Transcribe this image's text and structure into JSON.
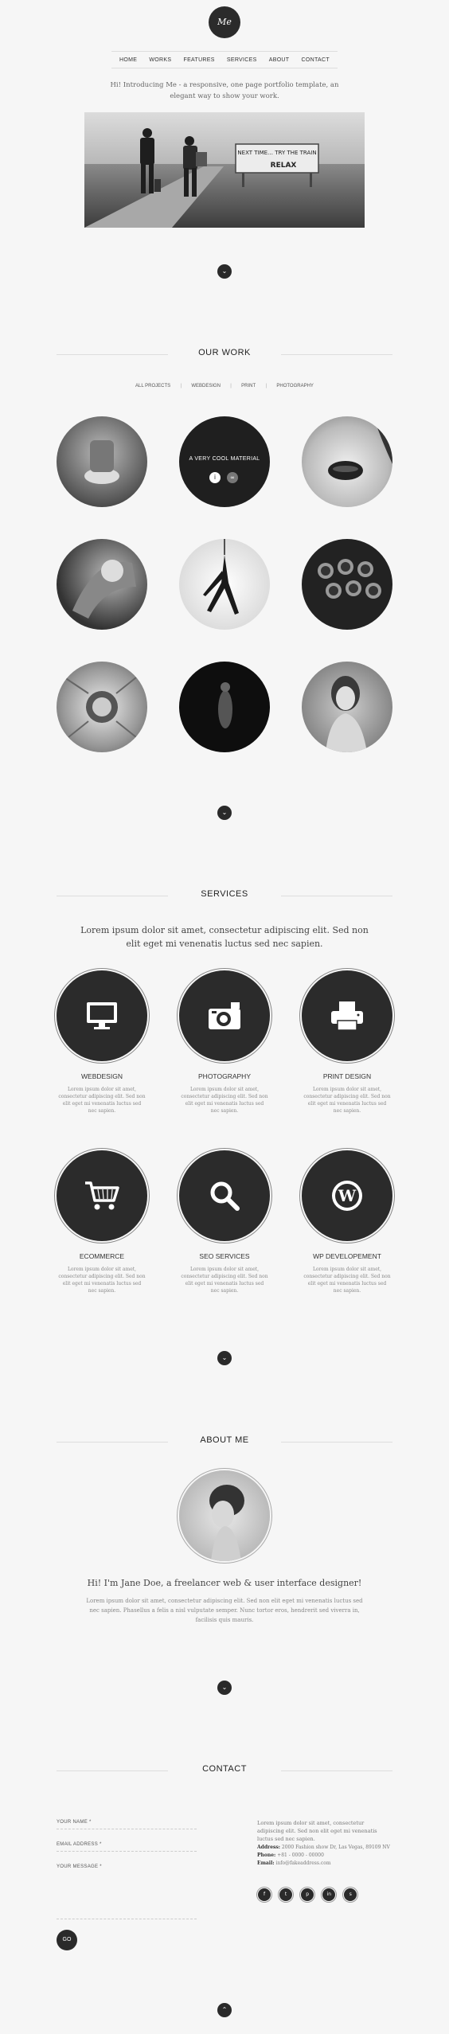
{
  "header": {
    "logo_text": "Me",
    "nav": [
      "HOME",
      "WORKS",
      "FEATURES",
      "SERVICES",
      "ABOUT",
      "CONTACT"
    ],
    "intro": "Hi! Introducing Me - a responsive, one page portfolio template, an elegant way to show your work."
  },
  "hero": {
    "billboard_line1": "NEXT TIME… TRY THE TRAIN",
    "billboard_line2": "RELAX"
  },
  "work": {
    "title": "OUR WORK",
    "filters": [
      "ALL PROJECTS",
      "WEBDESIGN",
      "PRINT",
      "PHOTOGRAPHY"
    ],
    "hover_label": "A VERY COOL MATERIAL"
  },
  "services": {
    "title": "SERVICES",
    "lead": "Lorem ipsum dolor sit amet, consectetur adipiscing elit. Sed non elit eget mi venenatis luctus sed nec sapien.",
    "items": [
      {
        "title": "WEBDESIGN",
        "desc": "Lorem ipsum dolor sit amet, consectetur adipiscing elit. Sed non elit eget mi venenatis luctus sed nec sapien.",
        "icon": "monitor-icon"
      },
      {
        "title": "PHOTOGRAPHY",
        "desc": "Lorem ipsum dolor sit amet, consectetur adipiscing elit. Sed non elit eget mi venenatis luctus sed nec sapien.",
        "icon": "camera-icon"
      },
      {
        "title": "PRINT DESIGN",
        "desc": "Lorem ipsum dolor sit amet, consectetur adipiscing elit. Sed non elit eget mi venenatis luctus sed nec sapien.",
        "icon": "printer-icon"
      },
      {
        "title": "ECOMMERCE",
        "desc": "Lorem ipsum dolor sit amet, consectetur adipiscing elit. Sed non elit eget mi venenatis luctus sed nec sapien.",
        "icon": "cart-icon"
      },
      {
        "title": "SEO SERVICES",
        "desc": "Lorem ipsum dolor sit amet, consectetur adipiscing elit. Sed non elit eget mi venenatis luctus sed nec sapien.",
        "icon": "search-icon"
      },
      {
        "title": "WP DEVELOPEMENT",
        "desc": "Lorem ipsum dolor sit amet, consectetur adipiscing elit. Sed non elit eget mi venenatis luctus sed nec sapien.",
        "icon": "wordpress-icon"
      }
    ]
  },
  "about": {
    "title": "ABOUT ME",
    "headline": "Hi! I'm Jane Doe, a freelancer web & user interface designer!",
    "text": "Lorem ipsum dolor sit amet, consectetur adipiscing elit. Sed non elit eget mi venenatis luctus sed nec sapien. Phasellus a felis a nisl vulputate semper. Nunc tortor eros, hendrerit sed viverra in, facilisis quis mauris."
  },
  "contact": {
    "title": "CONTACT",
    "labels": {
      "name": "YOUR NAME *",
      "email": "EMAIL ADDRESS *",
      "message": "YOUR MESSAGE *"
    },
    "submit": "GO",
    "text": "Lorem ipsum dolor sit amet, consectetur adipiscing elit. Sed non elit eget mi venenatis luctus sed nec sapien.",
    "address_label": "Address:",
    "address": "2000 Fashion show Dr, Las Vegas, 89109 NV",
    "phone_label": "Phone:",
    "phone": "+81 - 0000 - 00000",
    "email_label": "Email:",
    "email": "info@fakeaddress.com",
    "social": [
      "f",
      "t",
      "p",
      "in",
      "s"
    ]
  },
  "colors": {
    "dark": "#2b2b2b",
    "background": "#f6f6f6"
  }
}
